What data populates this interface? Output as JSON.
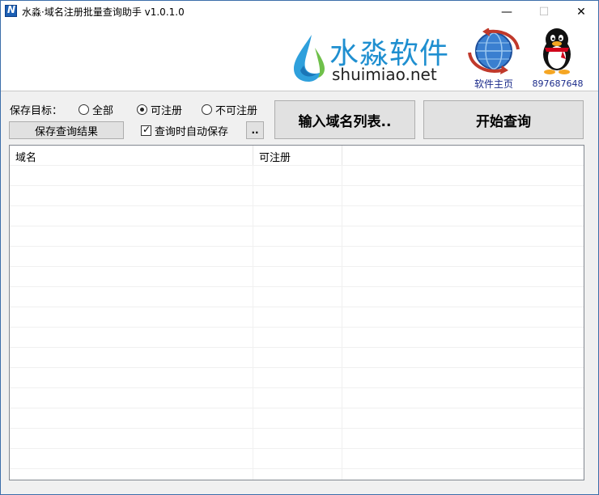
{
  "window": {
    "title": "水淼·域名注册批量查询助手 v1.0.1.0",
    "minimize_glyph": "—",
    "maximize_glyph": "☐",
    "close_glyph": "✕"
  },
  "banner": {
    "logo_cn": "水淼软件",
    "logo_en": "shuimiao.net",
    "logo_color": "#1f8fd0",
    "home_label": "软件主页",
    "qq_label": "897687648"
  },
  "controls": {
    "save_target_label": "保存目标：",
    "radio_all": "全部",
    "radio_available": "可注册",
    "radio_unavailable": "不可注册",
    "selected_radio": "可注册",
    "save_results_button": "保存查询结果",
    "auto_save_checkbox": "查询时自动保存",
    "auto_save_checked": true,
    "browse_button": "..",
    "input_domains_button": "输入域名列表..",
    "start_query_button": "开始查询"
  },
  "list": {
    "columns": [
      "域名",
      "可注册"
    ],
    "rows": []
  }
}
